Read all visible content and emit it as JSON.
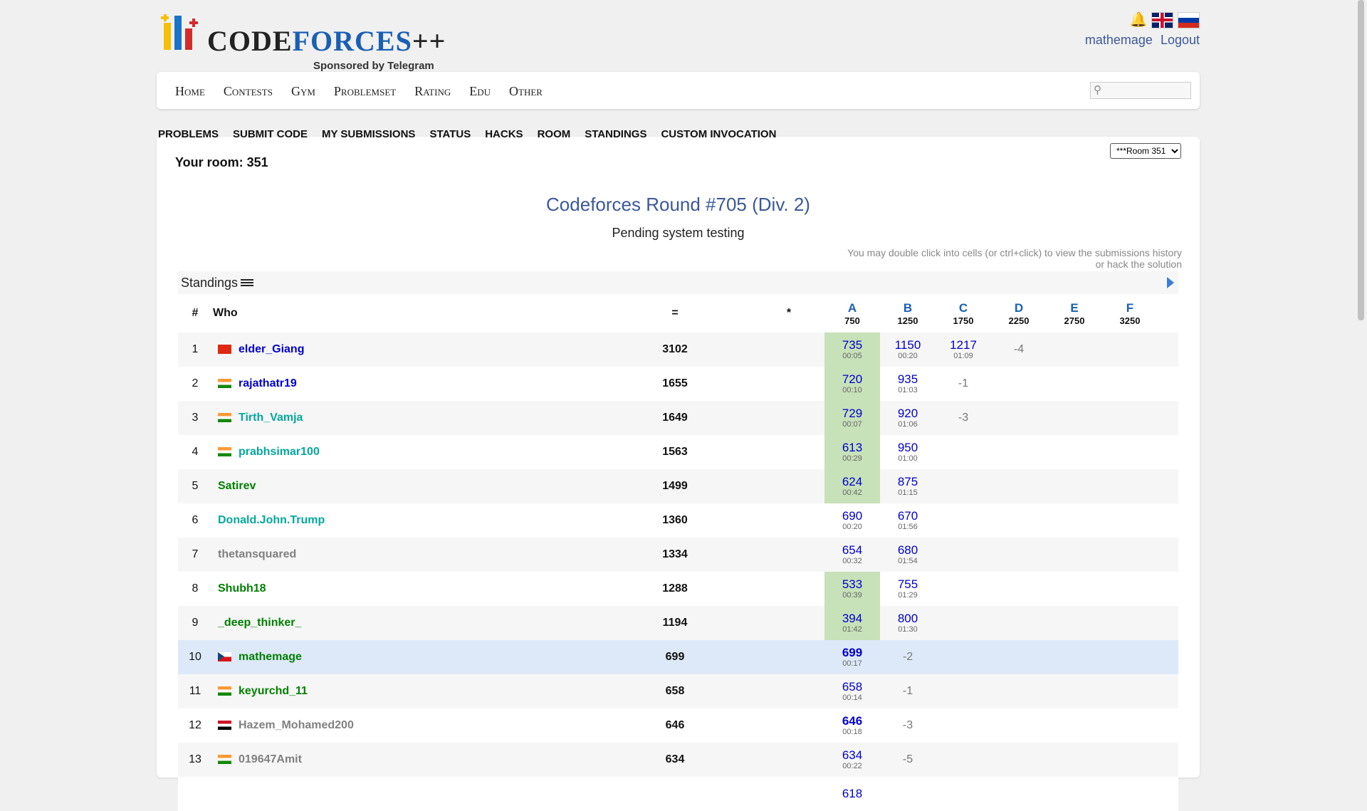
{
  "header": {
    "logo_text_a": "CODE",
    "logo_text_b": "FORCES",
    "logo_text_c": "++",
    "logo_sub": "Sponsored by Telegram",
    "user": "mathemage",
    "logout": "Logout"
  },
  "menu": [
    "Home",
    "Contests",
    "Gym",
    "Problemset",
    "Rating",
    "Edu",
    "Other"
  ],
  "second_menu": [
    "PROBLEMS",
    "SUBMIT CODE",
    "MY SUBMISSIONS",
    "STATUS",
    "HACKS",
    "ROOM",
    "STANDINGS",
    "CUSTOM INVOCATION"
  ],
  "room": {
    "label": "Your room: 351",
    "select": "***Room 351"
  },
  "contest": {
    "title": "Codeforces Round #705 (Div. 2)",
    "status": "Pending system testing",
    "hint": "You may double click into cells (or ctrl+click) to view the submissions history or hack the solution"
  },
  "standings": {
    "title": "Standings",
    "columns": {
      "rank": "#",
      "who": "Who",
      "score": "=",
      "penalty": "*"
    },
    "problems": [
      {
        "letter": "A",
        "points": "750"
      },
      {
        "letter": "B",
        "points": "1250"
      },
      {
        "letter": "C",
        "points": "1750"
      },
      {
        "letter": "D",
        "points": "2250"
      },
      {
        "letter": "E",
        "points": "2750"
      },
      {
        "letter": "F",
        "points": "3250"
      }
    ],
    "rows": [
      {
        "rank": "1",
        "flag": "cn",
        "handle": "elder_Giang",
        "color": "blue",
        "score": "3102",
        "cells": [
          {
            "v": "735",
            "t": "00:05",
            "acc": true
          },
          {
            "v": "1150",
            "t": "00:20"
          },
          {
            "v": "1217",
            "t": "01:09"
          },
          {
            "neg": "-4"
          },
          {},
          {}
        ]
      },
      {
        "rank": "2",
        "flag": "in",
        "handle": "rajathatr19",
        "color": "blue",
        "score": "1655",
        "cells": [
          {
            "v": "720",
            "t": "00:10",
            "acc": true
          },
          {
            "v": "935",
            "t": "01:03"
          },
          {
            "neg": "-1"
          },
          {},
          {},
          {}
        ]
      },
      {
        "rank": "3",
        "flag": "in",
        "handle": "Tirth_Vamja",
        "color": "cyan",
        "score": "1649",
        "cells": [
          {
            "v": "729",
            "t": "00:07",
            "acc": true
          },
          {
            "v": "920",
            "t": "01:06"
          },
          {
            "neg": "-3"
          },
          {},
          {},
          {}
        ]
      },
      {
        "rank": "4",
        "flag": "in",
        "handle": "prabhsimar100",
        "color": "cyan",
        "score": "1563",
        "cells": [
          {
            "v": "613",
            "t": "00:29",
            "acc": true
          },
          {
            "v": "950",
            "t": "01:00"
          },
          {},
          {},
          {},
          {}
        ]
      },
      {
        "rank": "5",
        "flag": "",
        "handle": "Satirev",
        "color": "green",
        "score": "1499",
        "cells": [
          {
            "v": "624",
            "t": "00:42",
            "acc": true
          },
          {
            "v": "875",
            "t": "01:15"
          },
          {},
          {},
          {},
          {}
        ]
      },
      {
        "rank": "6",
        "flag": "",
        "handle": "Donald.John.Trump",
        "color": "cyan",
        "score": "1360",
        "cells": [
          {
            "v": "690",
            "t": "00:20"
          },
          {
            "v": "670",
            "t": "01:56"
          },
          {},
          {},
          {},
          {}
        ]
      },
      {
        "rank": "7",
        "flag": "",
        "handle": "thetansquared",
        "color": "gray",
        "score": "1334",
        "cells": [
          {
            "v": "654",
            "t": "00:32"
          },
          {
            "v": "680",
            "t": "01:54"
          },
          {},
          {},
          {},
          {}
        ]
      },
      {
        "rank": "8",
        "flag": "",
        "handle": "Shubh18",
        "color": "green",
        "score": "1288",
        "cells": [
          {
            "v": "533",
            "t": "00:39",
            "acc": true
          },
          {
            "v": "755",
            "t": "01:29"
          },
          {},
          {},
          {},
          {}
        ]
      },
      {
        "rank": "9",
        "flag": "",
        "handle": "_deep_thinker_",
        "color": "green",
        "score": "1194",
        "cells": [
          {
            "v": "394",
            "t": "01:42",
            "acc": true
          },
          {
            "v": "800",
            "t": "01:30"
          },
          {},
          {},
          {},
          {}
        ]
      },
      {
        "rank": "10",
        "flag": "cz",
        "handle": "mathemage",
        "color": "green",
        "score": "699",
        "me": true,
        "cells": [
          {
            "v": "699",
            "t": "00:17",
            "bold": true
          },
          {
            "neg": "-2"
          },
          {},
          {},
          {},
          {}
        ]
      },
      {
        "rank": "11",
        "flag": "in",
        "handle": "keyurchd_11",
        "color": "green",
        "score": "658",
        "cells": [
          {
            "v": "658",
            "t": "00:14"
          },
          {
            "neg": "-1"
          },
          {},
          {},
          {},
          {}
        ]
      },
      {
        "rank": "12",
        "flag": "eg",
        "handle": "Hazem_Mohamed200",
        "color": "gray",
        "score": "646",
        "cells": [
          {
            "v": "646",
            "t": "00:18",
            "bold": true
          },
          {
            "neg": "-3"
          },
          {},
          {},
          {},
          {}
        ]
      },
      {
        "rank": "13",
        "flag": "in",
        "handle": "019647Amit",
        "color": "gray",
        "score": "634",
        "cells": [
          {
            "v": "634",
            "t": "00:22"
          },
          {
            "neg": "-5"
          },
          {},
          {},
          {},
          {}
        ]
      },
      {
        "rank": "",
        "flag": "",
        "handle": "",
        "color": "gray",
        "score": "",
        "cells": [
          {
            "v": "618",
            "t": ""
          },
          {},
          {},
          {},
          {},
          {}
        ]
      }
    ]
  }
}
